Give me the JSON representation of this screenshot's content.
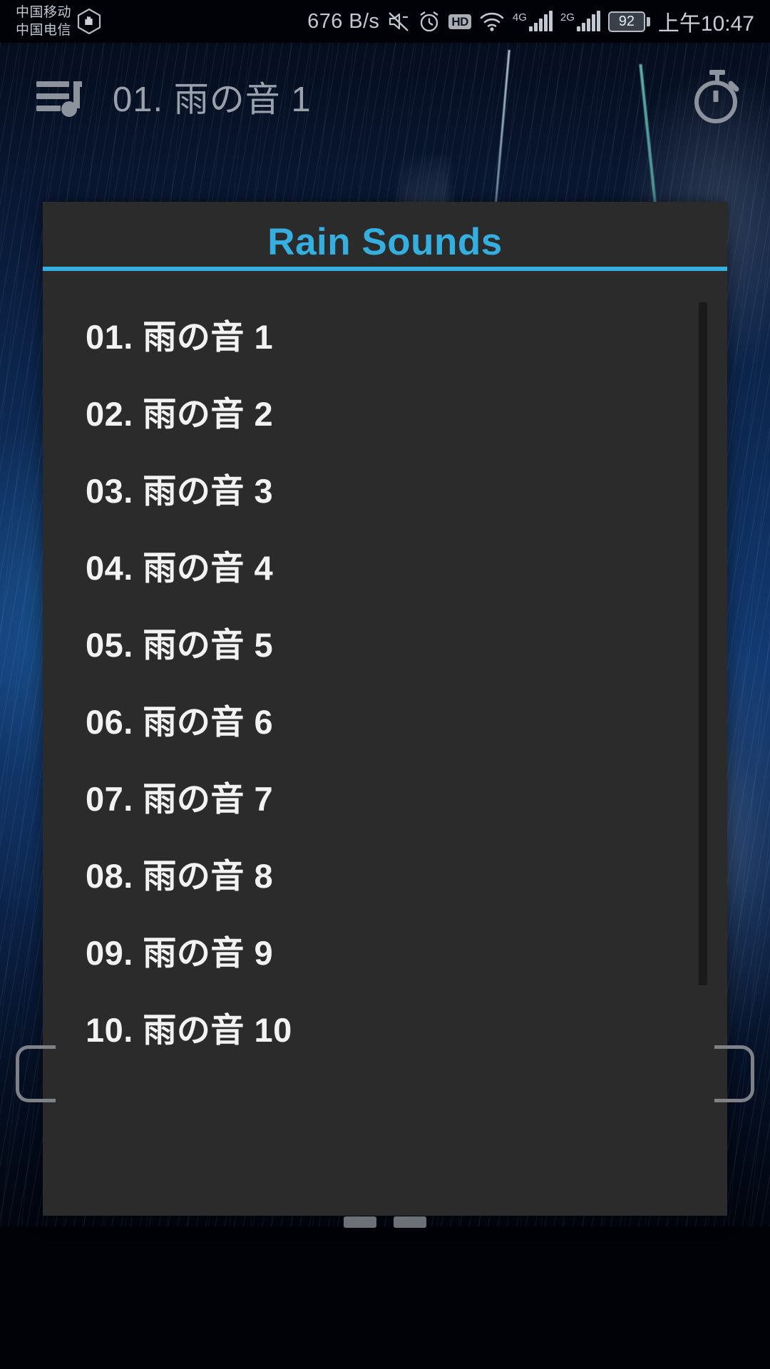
{
  "status_bar": {
    "carrier_line1": "中国移动",
    "carrier_line2": "中国电信",
    "dnd_icon": "do-not-disturb-hand-icon",
    "network_speed": "676 B/s",
    "mute_icon": "volume-mute-icon",
    "alarm_icon": "alarm-clock-icon",
    "hd_badge": "HD",
    "wifi_icon": "wifi-icon",
    "sim1_generation": "4G",
    "sim2_generation": "2G",
    "battery_level": "92",
    "clock": "上午10:47"
  },
  "app_bar": {
    "queue_icon": "playlist-queue-music-icon",
    "title": "01. 雨の音 1",
    "timer_icon": "sleep-timer-stopwatch-icon"
  },
  "dialog": {
    "title": "Rain Sounds",
    "accent_color": "#35aee0",
    "background_color": "#2b2b2b",
    "text_color": "#f2f2f2",
    "items": [
      {
        "label": "01. 雨の音 1"
      },
      {
        "label": "02. 雨の音 2"
      },
      {
        "label": "03. 雨の音 3"
      },
      {
        "label": "04. 雨の音 4"
      },
      {
        "label": "05. 雨の音 5"
      },
      {
        "label": "06. 雨の音 6"
      },
      {
        "label": "07. 雨の音 7"
      },
      {
        "label": "08. 雨の音 8"
      },
      {
        "label": "09. 雨の音 9"
      },
      {
        "label": "10. 雨の音 10"
      }
    ]
  },
  "system_nav": {
    "left_edge_handle": "edge-gesture-handle-left",
    "right_edge_handle": "edge-gesture-handle-right",
    "nav_hint_count": 2
  }
}
